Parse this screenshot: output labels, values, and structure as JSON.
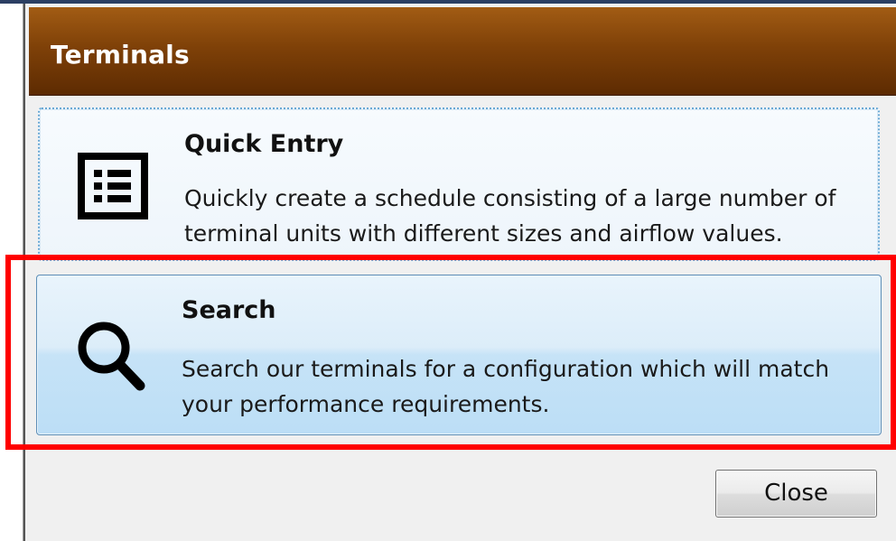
{
  "dialog": {
    "title": "Terminals",
    "options": [
      {
        "name": "quick-entry",
        "title": "Quick Entry",
        "description": "Quickly create a schedule consisting of a large number of terminal units with different sizes and airflow values.",
        "icon": "list-icon"
      },
      {
        "name": "search",
        "title": "Search",
        "description": "Search our terminals for a configuration which will match your performance requirements.",
        "icon": "search-icon"
      }
    ],
    "close_label": "Close"
  },
  "colors": {
    "title_bar": "#7f4108",
    "highlight": "#ff0000",
    "option_border": "#6aa8d4"
  }
}
